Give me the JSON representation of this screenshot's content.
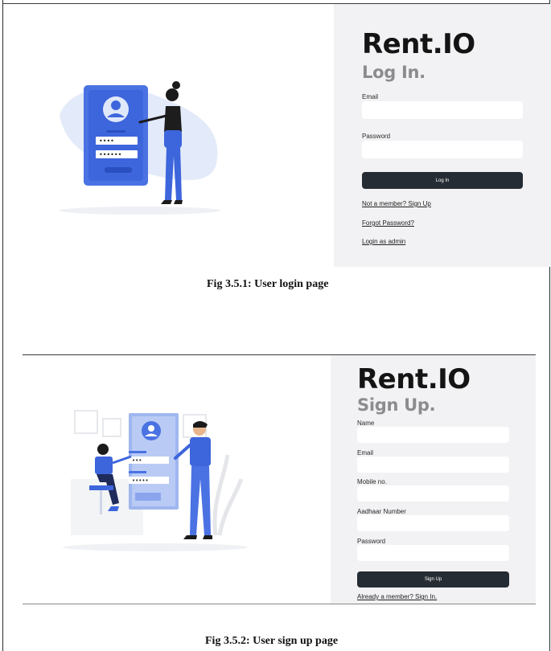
{
  "figure1": {
    "brand": "Rent.IO",
    "heading": "Log In.",
    "fields": [
      {
        "label": "Email",
        "value": ""
      },
      {
        "label": "Password",
        "value": ""
      }
    ],
    "submit_label": "Log In",
    "links": [
      "Not a member? Sign Up",
      "Forgot Password?",
      "Login as admin"
    ],
    "caption": "Fig 3.5.1: User login page",
    "illustration": "person-login-phone-illustration",
    "colors": {
      "panel_bg": "#f2f2f4",
      "button_bg": "#262c33",
      "accent": "#3d6be0"
    }
  },
  "figure2": {
    "brand": "Rent.IO",
    "heading": "Sign Up.",
    "fields": [
      {
        "label": "Name",
        "value": ""
      },
      {
        "label": "Email",
        "value": ""
      },
      {
        "label": "Mobile no.",
        "value": ""
      },
      {
        "label": "Aadhaar Number",
        "value": ""
      },
      {
        "label": "Password",
        "value": ""
      }
    ],
    "submit_label": "Sign Up",
    "link": "Already a member? Sign In.",
    "caption": "Fig 3.5.2: User sign up page",
    "illustration": "two-people-signup-screen-illustration"
  }
}
